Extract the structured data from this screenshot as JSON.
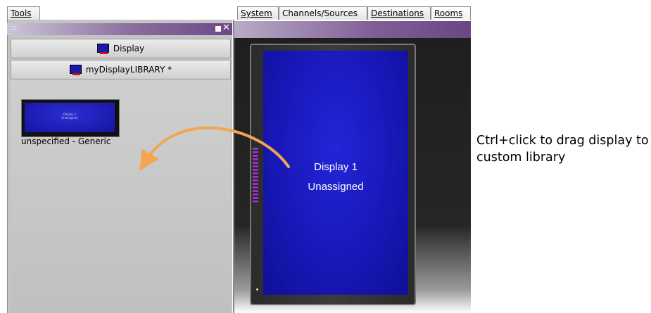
{
  "left_panel": {
    "tab_label": "Tools",
    "grip": "::::",
    "buttons": {
      "display": "Display",
      "my_library": "myDisplayLIBRARY *"
    },
    "library_items": [
      {
        "label": "unspecified - Generic",
        "screen_text": "Display 1\nUnassigned"
      }
    ]
  },
  "right_panel": {
    "tabs": [
      "System",
      "Channels/Sources",
      "Destinations",
      "Rooms"
    ],
    "active_tab": "Rooms",
    "display": {
      "name": "Display 1",
      "status": "Unassigned"
    }
  },
  "annotation": {
    "text": "Ctrl+click to drag display to custom library",
    "arrow_color": "#f2a552"
  },
  "colors": {
    "titlebar_purple": "#6d4887",
    "display_blue": "#1818b8"
  },
  "icons": {
    "monitor": "monitor-icon",
    "close": "close-icon",
    "maximize": "maximize-icon",
    "grip": "grip-icon"
  }
}
